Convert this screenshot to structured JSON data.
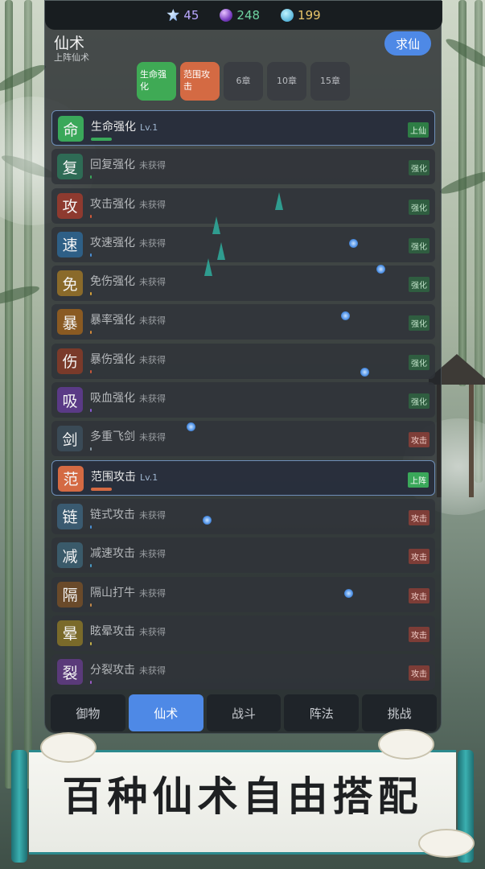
{
  "currency": [
    {
      "icon": "ice-crystal-icon",
      "value": "45",
      "color": "#b9a8ff"
    },
    {
      "icon": "purple-orb-icon",
      "value": "248",
      "color": "#6ed2a0"
    },
    {
      "icon": "spirit-drop-icon",
      "value": "199",
      "color": "#e8c56a"
    }
  ],
  "header": {
    "title": "仙术",
    "subtitle": "上阵仙术",
    "seek_button": "求仙"
  },
  "filters": [
    {
      "label": "生命强化",
      "style": "green"
    },
    {
      "label": "范围攻击",
      "style": "orange"
    },
    {
      "label": "6章",
      "style": "gray"
    },
    {
      "label": "10章",
      "style": "gray"
    },
    {
      "label": "15章",
      "style": "gray"
    }
  ],
  "skills": [
    {
      "glyph": "命",
      "name": "生命强化",
      "level": "Lv.1",
      "tag": "上仙",
      "icon_color": "#3aa85a",
      "bar_color": "#3aa85a",
      "active": true,
      "tag_style": "green"
    },
    {
      "glyph": "复",
      "name": "回复强化",
      "level": "未获得",
      "tag": "强化",
      "icon_color": "#2e6b55",
      "bar_color": "#3aa85a",
      "active": false,
      "tag_style": "green-dim"
    },
    {
      "glyph": "攻",
      "name": "攻击强化",
      "level": "未获得",
      "tag": "强化",
      "icon_color": "#8e3a2f",
      "bar_color": "#d25a3a",
      "active": false,
      "tag_style": "green-dim"
    },
    {
      "glyph": "速",
      "name": "攻速强化",
      "level": "未获得",
      "tag": "强化",
      "icon_color": "#2e5f86",
      "bar_color": "#4a8fd4",
      "active": false,
      "tag_style": "green-dim"
    },
    {
      "glyph": "免",
      "name": "免伤强化",
      "level": "未获得",
      "tag": "强化",
      "icon_color": "#8a6a2a",
      "bar_color": "#d4a03a",
      "active": false,
      "tag_style": "green-dim"
    },
    {
      "glyph": "暴",
      "name": "暴率强化",
      "level": "未获得",
      "tag": "强化",
      "icon_color": "#8a5a22",
      "bar_color": "#d48a3a",
      "active": false,
      "tag_style": "green-dim"
    },
    {
      "glyph": "伤",
      "name": "暴伤强化",
      "level": "未获得",
      "tag": "强化",
      "icon_color": "#7a3a2a",
      "bar_color": "#c8563a",
      "active": false,
      "tag_style": "green-dim"
    },
    {
      "glyph": "吸",
      "name": "吸血强化",
      "level": "未获得",
      "tag": "强化",
      "icon_color": "#5a3a86",
      "bar_color": "#8a5ad4",
      "active": false,
      "tag_style": "green-dim"
    },
    {
      "glyph": "剑",
      "name": "多重飞剑",
      "level": "未获得",
      "tag": "攻击",
      "icon_color": "#3a4a56",
      "bar_color": "#8a9aa6",
      "active": false,
      "tag_style": "red-dim"
    },
    {
      "glyph": "范",
      "name": "范围攻击",
      "level": "Lv.1",
      "tag": "上阵",
      "icon_color": "#d46a43",
      "bar_color": "#d46a43",
      "active": true,
      "tag_style": "green-solid"
    },
    {
      "glyph": "链",
      "name": "链式攻击",
      "level": "未获得",
      "tag": "攻击",
      "icon_color": "#3a5a70",
      "bar_color": "#4a8fd4",
      "active": false,
      "tag_style": "red-dim"
    },
    {
      "glyph": "减",
      "name": "减速攻击",
      "level": "未获得",
      "tag": "攻击",
      "icon_color": "#3a5a6a",
      "bar_color": "#4a9ac4",
      "active": false,
      "tag_style": "red-dim"
    },
    {
      "glyph": "隔",
      "name": "隔山打牛",
      "level": "未获得",
      "tag": "攻击",
      "icon_color": "#6a4a2a",
      "bar_color": "#c48a4a",
      "active": false,
      "tag_style": "red-dim"
    },
    {
      "glyph": "晕",
      "name": "眩晕攻击",
      "level": "未获得",
      "tag": "攻击",
      "icon_color": "#7a6a2a",
      "bar_color": "#c4b04a",
      "active": false,
      "tag_style": "red-dim"
    },
    {
      "glyph": "裂",
      "name": "分裂攻击",
      "level": "未获得",
      "tag": "攻击",
      "icon_color": "#5a3a7a",
      "bar_color": "#9a5ac4",
      "active": false,
      "tag_style": "red-dim"
    }
  ],
  "tabs": [
    {
      "label": "御物",
      "active": false
    },
    {
      "label": "仙术",
      "active": true
    },
    {
      "label": "战斗",
      "active": false
    },
    {
      "label": "阵法",
      "active": false
    },
    {
      "label": "挑战",
      "active": false
    }
  ],
  "banner": {
    "text": "百种仙术自由搭配"
  }
}
